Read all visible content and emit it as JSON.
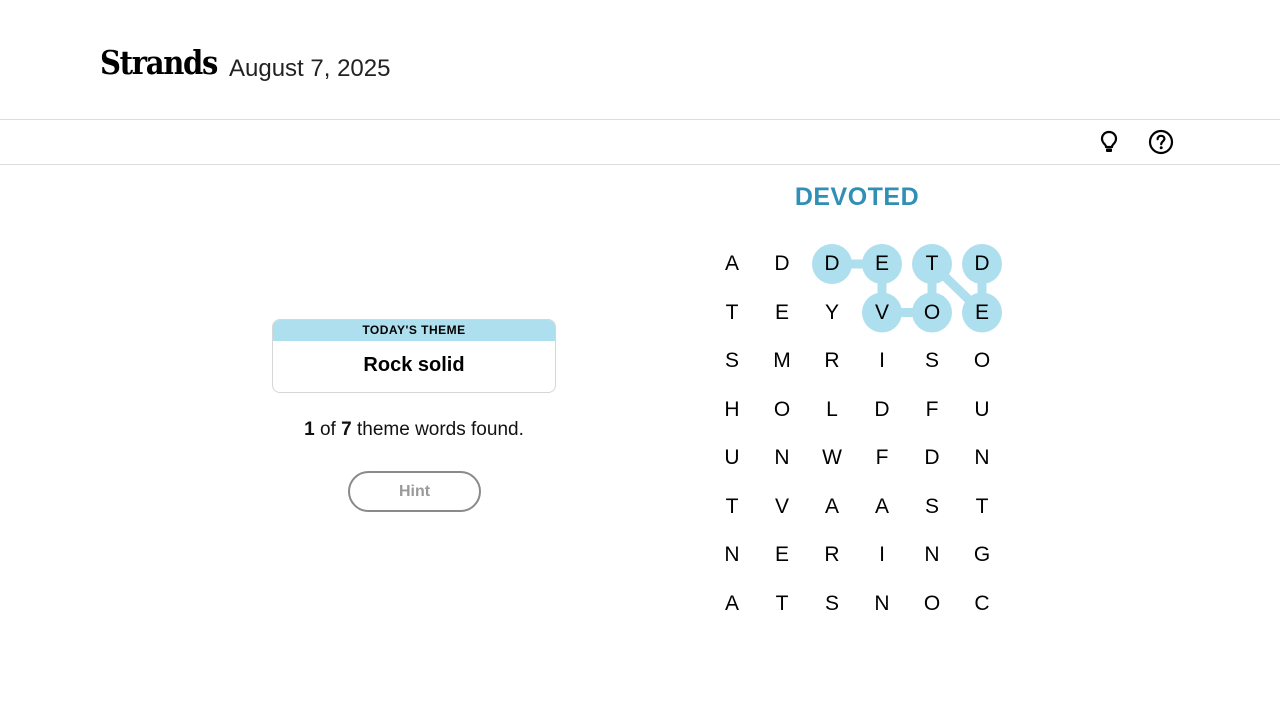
{
  "header": {
    "logo": "Strands",
    "date": "August 7, 2025"
  },
  "toolbar": {
    "icons": [
      "lightbulb-icon",
      "help-icon"
    ]
  },
  "theme": {
    "label": "TODAY'S THEME",
    "text": "Rock solid"
  },
  "progress": {
    "found": "1",
    "of": "of",
    "total": "7",
    "suffix": "theme words found."
  },
  "hint_label": "Hint",
  "current_word": "DEVOTED",
  "colors": {
    "highlight": "#aedfee",
    "accent": "#2f8fb5"
  },
  "grid": [
    [
      "A",
      "D",
      "D",
      "E",
      "T",
      "D"
    ],
    [
      "T",
      "E",
      "Y",
      "V",
      "O",
      "E"
    ],
    [
      "S",
      "M",
      "R",
      "I",
      "S",
      "O"
    ],
    [
      "H",
      "O",
      "L",
      "D",
      "F",
      "U"
    ],
    [
      "U",
      "N",
      "W",
      "F",
      "D",
      "N"
    ],
    [
      "T",
      "V",
      "A",
      "A",
      "S",
      "T"
    ],
    [
      "N",
      "E",
      "R",
      "I",
      "N",
      "G"
    ],
    [
      "A",
      "T",
      "S",
      "N",
      "O",
      "C"
    ]
  ],
  "highlighted_path": [
    [
      0,
      2
    ],
    [
      0,
      3
    ],
    [
      1,
      3
    ],
    [
      1,
      4
    ],
    [
      0,
      4
    ],
    [
      1,
      5
    ],
    [
      0,
      5
    ]
  ]
}
